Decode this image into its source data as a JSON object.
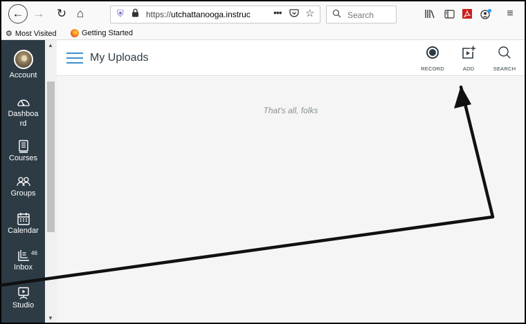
{
  "browser": {
    "url_prefix": "https://",
    "url_domain": "utchattanooga.instruc",
    "search_placeholder": "Search",
    "bookmarks": [
      {
        "label": "Most Visited"
      },
      {
        "label": "Getting Started"
      }
    ],
    "icons": {
      "back": "back-arrow-icon",
      "forward": "forward-arrow-icon",
      "reload": "reload-icon",
      "home": "home-icon",
      "shield": "shield-icon",
      "lock": "lock-icon",
      "more": "ellipsis-icon",
      "pocket": "pocket-icon",
      "star": "star-icon",
      "library": "library-icon",
      "sidebar": "sidebar-icon",
      "pdf": "pdf-icon",
      "account": "account-icon",
      "menu": "hamburger-menu-icon"
    }
  },
  "leftnav": {
    "items": [
      {
        "label": "Account",
        "icon": "avatar"
      },
      {
        "label": "Dashboa\nrd",
        "icon": "dashboard-icon"
      },
      {
        "label": "Courses",
        "icon": "courses-icon"
      },
      {
        "label": "Groups",
        "icon": "groups-icon"
      },
      {
        "label": "Calendar",
        "icon": "calendar-icon"
      },
      {
        "label": "Inbox",
        "icon": "inbox-icon",
        "badge": "46"
      },
      {
        "label": "Studio",
        "icon": "studio-icon"
      }
    ],
    "colors": {
      "background": "#2d3b45",
      "text": "#ffffff"
    }
  },
  "page": {
    "title": "My Uploads",
    "actions": [
      {
        "label": "RECORD",
        "icon": "record-icon"
      },
      {
        "label": "ADD",
        "icon": "add-media-icon"
      },
      {
        "label": "SEARCH",
        "icon": "search-icon"
      }
    ],
    "empty_message": "That's all, folks"
  },
  "colors": {
    "accent": "#3a8fd1",
    "content_bg": "#f5f5f5"
  }
}
